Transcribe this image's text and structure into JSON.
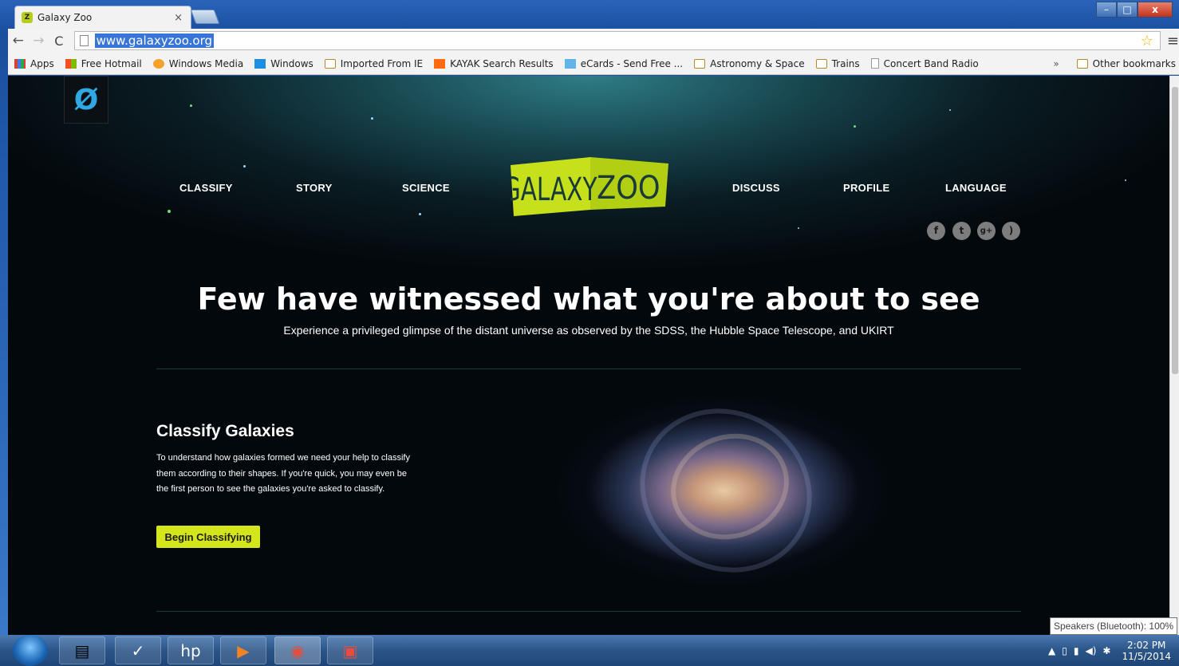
{
  "browser": {
    "tab_title": "Galaxy Zoo",
    "tab_close": "×",
    "url": "www.galaxyzoo.org",
    "window_buttons": {
      "minimize": "–",
      "maximize": "□",
      "close": "x"
    }
  },
  "bookmarks": {
    "items": [
      {
        "label": "Apps",
        "icon": "apps-grid-icon"
      },
      {
        "label": "Free Hotmail",
        "icon": "windows-flag-icon"
      },
      {
        "label": "Windows Media",
        "icon": "windows-media-icon"
      },
      {
        "label": "Windows",
        "icon": "windows-logo-icon"
      },
      {
        "label": "Imported From IE",
        "icon": "folder-icon"
      },
      {
        "label": "KAYAK Search Results",
        "icon": "kayak-icon"
      },
      {
        "label": "eCards - Send Free ...",
        "icon": "ecards-icon"
      },
      {
        "label": "Astronomy & Space",
        "icon": "folder-icon"
      },
      {
        "label": "Trains",
        "icon": "folder-icon"
      },
      {
        "label": "Concert Band Radio",
        "icon": "page-icon"
      }
    ],
    "more": "»",
    "other": "Other bookmarks"
  },
  "site": {
    "nav_left": [
      "CLASSIFY",
      "STORY",
      "SCIENCE"
    ],
    "nav_right": [
      "DISCUSS",
      "PROFILE",
      "LANGUAGE"
    ],
    "logo_text_1": "GALAXY",
    "logo_text_2": "ZOO",
    "social": [
      "f",
      "t",
      "g+",
      "rss"
    ],
    "headline": "Few have witnessed what you're about to see",
    "subheadline": "Experience a privileged glimpse of the distant universe as observed by the SDSS, the Hubble Space Telescope, and UKIRT",
    "classify": {
      "title": "Classify Galaxies",
      "body": "To understand how galaxies formed we need your help to classify them according to their shapes. If you're quick, you may even be the first person to see the galaxies you're asked to classify.",
      "button": "Begin Classifying"
    }
  },
  "taskbar": {
    "time": "2:02 PM",
    "date": "11/5/2014",
    "tooltip": "Speakers (Bluetooth): 100%"
  },
  "colors": {
    "accent_green": "#d3e51b",
    "selection_blue": "#3875d7"
  }
}
